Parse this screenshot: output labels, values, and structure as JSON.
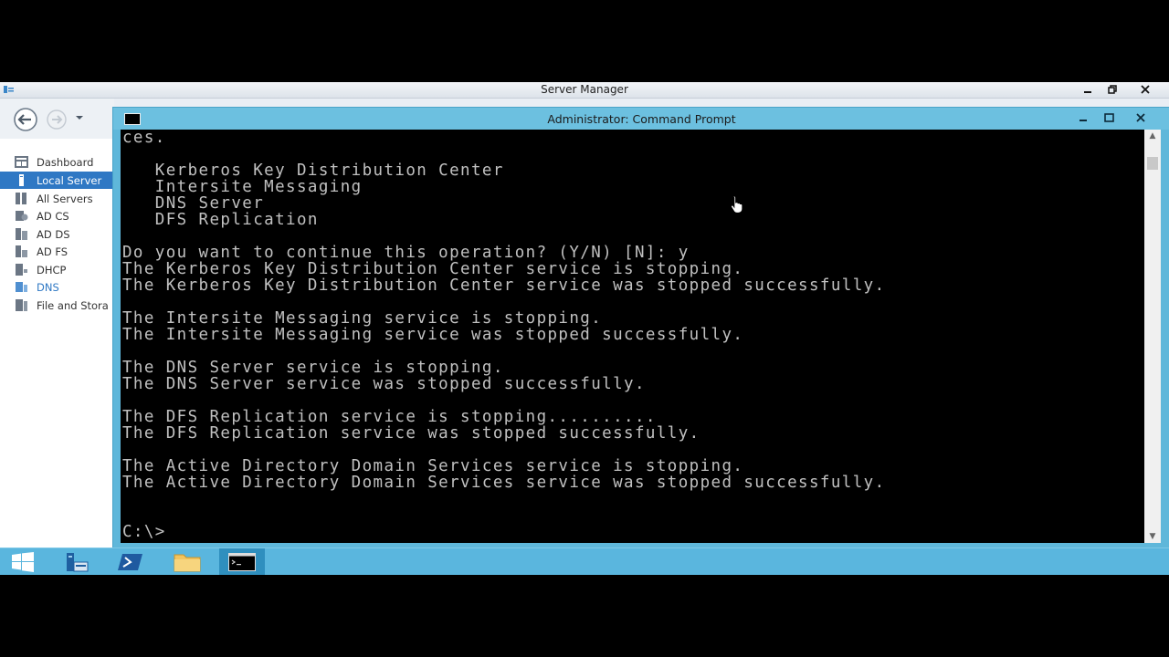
{
  "server_manager": {
    "title": "Server Manager",
    "sidebar": [
      {
        "label": "Dashboard",
        "icon": "dashboard-icon"
      },
      {
        "label": "Local Server",
        "icon": "local-server-icon",
        "active": true
      },
      {
        "label": "All Servers",
        "icon": "all-servers-icon"
      },
      {
        "label": "AD CS",
        "icon": "ad-cs-icon"
      },
      {
        "label": "AD DS",
        "icon": "ad-ds-icon"
      },
      {
        "label": "AD FS",
        "icon": "ad-fs-icon"
      },
      {
        "label": "DHCP",
        "icon": "dhcp-icon"
      },
      {
        "label": "DNS",
        "icon": "dns-icon"
      },
      {
        "label": "File and Stora",
        "icon": "file-storage-icon"
      }
    ]
  },
  "cmd": {
    "title": "Administrator: Command Prompt",
    "lines": [
      "ces.",
      "",
      "   Kerberos Key Distribution Center",
      "   Intersite Messaging",
      "   DNS Server",
      "   DFS Replication",
      "",
      "Do you want to continue this operation? (Y/N) [N]: y",
      "The Kerberos Key Distribution Center service is stopping.",
      "The Kerberos Key Distribution Center service was stopped successfully.",
      "",
      "The Intersite Messaging service is stopping.",
      "The Intersite Messaging service was stopped successfully.",
      "",
      "The DNS Server service is stopping.",
      "The DNS Server service was stopped successfully.",
      "",
      "The DFS Replication service is stopping..........",
      "The DFS Replication service was stopped successfully.",
      "",
      "The Active Directory Domain Services service is stopping.",
      "The Active Directory Domain Services service was stopped successfully.",
      "",
      "",
      "C:\\>"
    ]
  },
  "taskbar": [
    {
      "name": "start-button",
      "icon": "windows-logo-icon"
    },
    {
      "name": "server-manager-taskbar-button",
      "icon": "server-manager-icon"
    },
    {
      "name": "powershell-taskbar-button",
      "icon": "powershell-icon"
    },
    {
      "name": "file-explorer-taskbar-button",
      "icon": "folder-icon"
    },
    {
      "name": "command-prompt-taskbar-button",
      "icon": "cmd-icon",
      "active": true
    }
  ],
  "colors": {
    "accent": "#2f78c4",
    "window_frame": "#6cc0e0",
    "console_bg": "#000000",
    "console_text": "#c0c0c0",
    "taskbar": "#5ab6de"
  }
}
